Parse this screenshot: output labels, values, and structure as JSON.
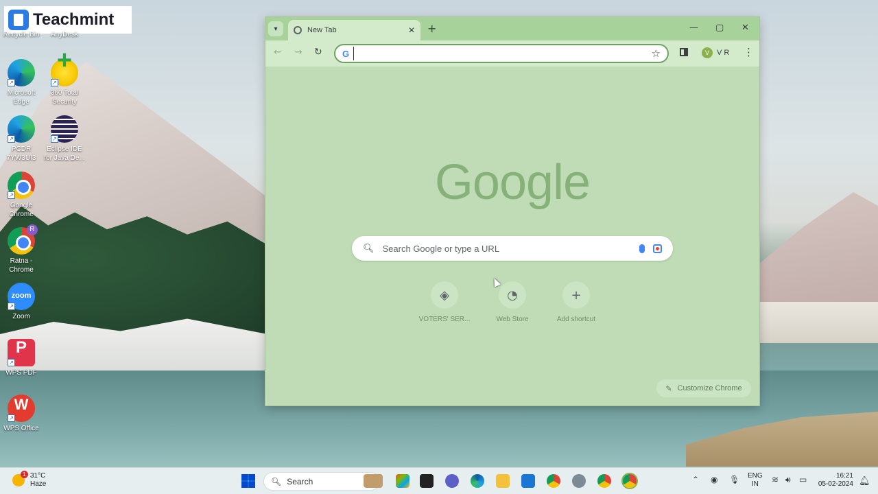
{
  "branding": {
    "logo_text": "Teachmint"
  },
  "desktop": {
    "icons": [
      {
        "id": "recycle",
        "label": "Recycle Bin"
      },
      {
        "id": "anydesk",
        "label": "AnyDesk"
      },
      {
        "id": "edge",
        "label": "Microsoft Edge"
      },
      {
        "id": "total360",
        "label": "360 Total Security"
      },
      {
        "id": "pcdr",
        "label": "PCDR 7YW3UI3"
      },
      {
        "id": "eclipse",
        "label": "Eclipse IDE for Java De..."
      },
      {
        "id": "chrome",
        "label": "Google Chrome"
      },
      {
        "id": "ratna",
        "label": "Ratna - Chrome"
      },
      {
        "id": "zoom",
        "label": "Zoom"
      },
      {
        "id": "wpspdf",
        "label": "WPS PDF"
      },
      {
        "id": "wpsoffice",
        "label": "WPS Office"
      }
    ]
  },
  "browser": {
    "tab_title": "New Tab",
    "omnibox_value": "",
    "profile_initial": "V",
    "profile_name": "V R",
    "google_logo": "Google",
    "search_placeholder": "Search Google or type a URL",
    "shortcuts": [
      {
        "label": "VOTERS' SER..."
      },
      {
        "label": "Web Store"
      },
      {
        "label": "Add shortcut"
      }
    ],
    "customize_label": "Customize Chrome"
  },
  "taskbar": {
    "temperature": "31°C",
    "weather": "Haze",
    "search_label": "Search",
    "lang_top": "ENG",
    "lang_bottom": "IN",
    "time": "16:21",
    "date": "05-02-2024"
  }
}
